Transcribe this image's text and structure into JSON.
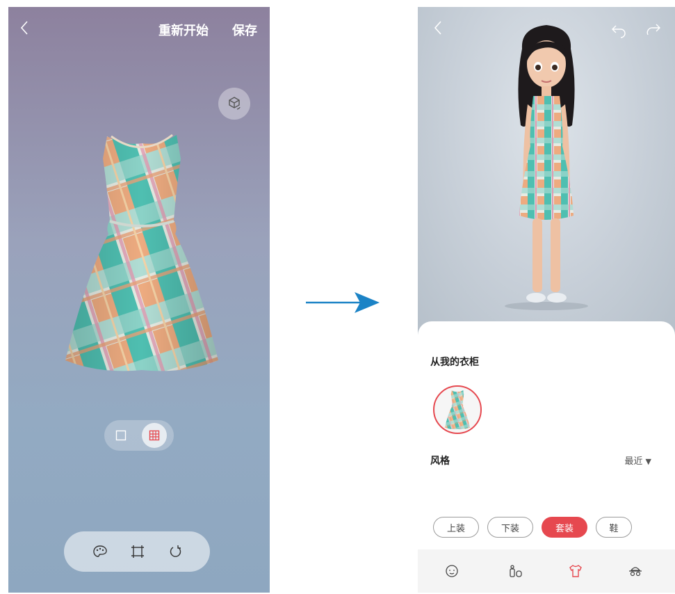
{
  "left": {
    "back_icon": "chevron-left-icon",
    "restart_label": "重新开始",
    "save_label": "保存",
    "rotate_icon": "rotate-3d-icon",
    "view_toggle": [
      "plain-view-icon",
      "pattern-view-icon"
    ],
    "tools": [
      "palette-icon",
      "crop-icon",
      "reset-icon"
    ]
  },
  "right": {
    "back_icon": "chevron-left-icon",
    "undo_icon": "undo-icon",
    "redo_icon": "redo-icon",
    "wardrobe_title": "从我的衣柜",
    "style_label": "风格",
    "sort_label": "最近",
    "categories": [
      {
        "label": "上装"
      },
      {
        "label": "下装"
      },
      {
        "label": "套装",
        "selected": true
      },
      {
        "label": "鞋"
      }
    ],
    "nav": [
      "face-icon",
      "body-icon",
      "clothing-icon",
      "accessory-icon"
    ],
    "accent_color": "#e6484f"
  }
}
